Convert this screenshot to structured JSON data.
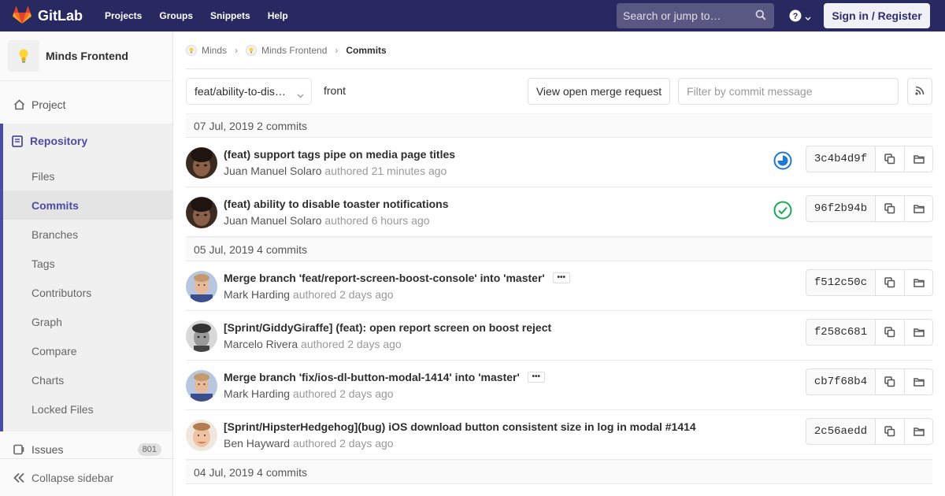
{
  "navbar": {
    "brand": "GitLab",
    "links": [
      "Projects",
      "Groups",
      "Snippets",
      "Help"
    ],
    "search_placeholder": "Search or jump to…",
    "signin_label": "Sign in / Register"
  },
  "sidebar": {
    "project_name": "Minds Frontend",
    "project_item": "Project",
    "repository_label": "Repository",
    "repo_items": [
      "Files",
      "Commits",
      "Branches",
      "Tags",
      "Contributors",
      "Graph",
      "Compare",
      "Charts",
      "Locked Files"
    ],
    "active_repo_item": "Commits",
    "issues_label": "Issues",
    "issues_count": "801",
    "collapse_label": "Collapse sidebar"
  },
  "breadcrumb": {
    "group": "Minds",
    "project": "Minds Frontend",
    "current": "Commits"
  },
  "toolbar": {
    "branch": "feat/ability-to-dis…",
    "path": "front",
    "merge_request_label": "View open merge request",
    "filter_placeholder": "Filter by commit message"
  },
  "days": [
    {
      "header": "07 Jul, 2019 2 commits",
      "commits": [
        {
          "title": "(feat) support tags pipe on media page titles",
          "author": "Juan Manuel Solaro",
          "authored": "authored 21 minutes ago",
          "sha": "3c4b4d9f",
          "status": "running",
          "has_ellipsis": false,
          "avatar": "juan"
        },
        {
          "title": "(feat) ability to disable toaster notifications",
          "author": "Juan Manuel Solaro",
          "authored": "authored 6 hours ago",
          "sha": "96f2b94b",
          "status": "passed",
          "has_ellipsis": false,
          "avatar": "juan"
        }
      ]
    },
    {
      "header": "05 Jul, 2019 4 commits",
      "commits": [
        {
          "title": "Merge branch 'feat/report-screen-boost-console' into 'master'",
          "author": "Mark Harding",
          "authored": "authored 2 days ago",
          "sha": "f512c50c",
          "status": "",
          "has_ellipsis": true,
          "avatar": "mark"
        },
        {
          "title": "[Sprint/GiddyGiraffe] (feat): open report screen on boost reject",
          "author": "Marcelo Rivera",
          "authored": "authored 2 days ago",
          "sha": "f258c681",
          "status": "",
          "has_ellipsis": false,
          "avatar": "marcelo"
        },
        {
          "title": "Merge branch 'fix/ios-dl-button-modal-1414' into 'master'",
          "author": "Mark Harding",
          "authored": "authored 2 days ago",
          "sha": "cb7f68b4",
          "status": "",
          "has_ellipsis": true,
          "avatar": "mark"
        },
        {
          "title": "[Sprint/HipsterHedgehog](bug) iOS download button consistent size in log in modal #1414",
          "author": "Ben Hayward",
          "authored": "authored 2 days ago",
          "sha": "2c56aedd",
          "status": "",
          "has_ellipsis": false,
          "avatar": "ben"
        }
      ]
    },
    {
      "header": "04 Jul, 2019 4 commits",
      "commits": []
    }
  ],
  "colors": {
    "navbar": "#292961",
    "accent": "#4b4ba3",
    "passed": "#1aaa55",
    "running": "#1f78d1"
  },
  "icons": {
    "brand": "gitlab-tanuki-icon",
    "search": "search-icon",
    "help": "question-circle-icon",
    "project": "home-icon",
    "repository": "book-icon",
    "issues": "issues-icon",
    "collapse": "double-chevron-left-icon",
    "copy": "copy-icon",
    "browse": "folder-open-icon",
    "rss": "rss-icon"
  }
}
